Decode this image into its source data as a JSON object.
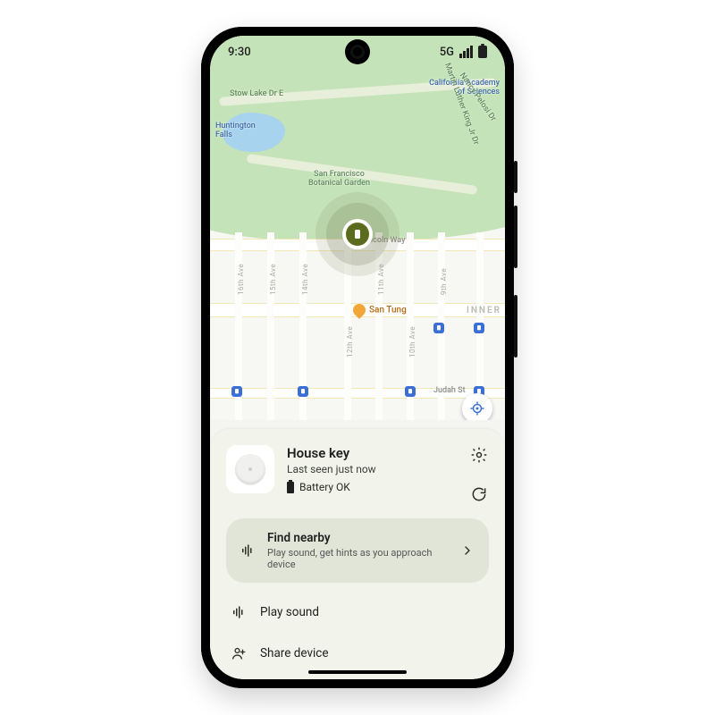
{
  "status": {
    "time": "9:30",
    "net": "5G"
  },
  "map": {
    "labels": {
      "stow_lake": "Stow Lake Dr E",
      "huntington": "Huntington\nFalls",
      "botanical": "San Francisco\nBotanical Garden",
      "cas": "California Academy\nof Sciences",
      "mlk": "Martin Luther King Jr Dr",
      "nancy": "Nancy Pelosi Dr",
      "lincoln": "Lincoln Way",
      "judah": "Judah St",
      "area_inner": "INNER",
      "aves": [
        "16th Ave",
        "15th Ave",
        "14th Ave",
        "12th Ave",
        "11th Ave",
        "10th Ave",
        "9th Ave"
      ]
    },
    "poi": {
      "san_tung": "San Tung"
    }
  },
  "device": {
    "name": "House key",
    "last_seen": "Last seen just now",
    "battery": "Battery OK"
  },
  "actions": {
    "find_title": "Find nearby",
    "find_sub": "Play sound, get hints as you approach device",
    "play_sound": "Play sound",
    "share": "Share device"
  },
  "icons": {
    "settings": "gear-icon",
    "refresh": "refresh-icon",
    "waves": "sound-waves-icon",
    "chevron": "chevron-right-icon",
    "share": "person-add-icon",
    "device": "phone-icon"
  }
}
